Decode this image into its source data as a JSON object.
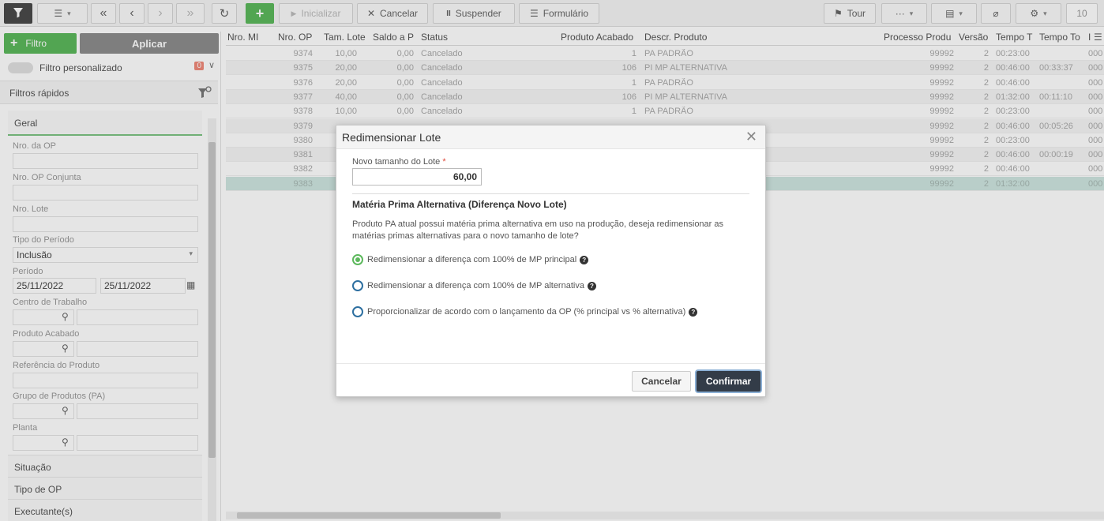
{
  "toolbar": {
    "inicializar": "Inicializar",
    "cancelar": "Cancelar",
    "suspender": "Suspender",
    "formulario": "Formulário",
    "tour": "Tour",
    "page_size": "10"
  },
  "filters": {
    "filtro_btn": "Filtro",
    "aplicar_btn": "Aplicar",
    "personalizado_label": "Filtro personalizado",
    "personalizado_count": "0",
    "rapidos": "Filtros rápidos",
    "geral": "Geral",
    "nro_op": "Nro. da OP",
    "nro_op_conjunta": "Nro. OP Conjunta",
    "nro_lote": "Nro. Lote",
    "tipo_periodo": "Tipo do Período",
    "tipo_periodo_value": "Inclusão",
    "periodo": "Período",
    "periodo_from": "25/11/2022",
    "periodo_to": "25/11/2022",
    "centro_trabalho": "Centro de Trabalho",
    "produto_acabado": "Produto Acabado",
    "referencia_produto": "Referência do Produto",
    "grupo_produtos": "Grupo de Produtos (PA)",
    "planta": "Planta",
    "situacao": "Situação",
    "tipo_op": "Tipo de OP",
    "executantes": "Executante(s)"
  },
  "grid": {
    "headers": [
      "Nro. MI",
      "Nro. OP",
      "Tam. Lote",
      "Saldo a P",
      "Status",
      "Produto Acabado",
      "Descr. Produto",
      "Processo Produ",
      "Versão",
      "Tempo T",
      "Tempo To",
      "I"
    ],
    "rows": [
      [
        "9374",
        "10,00",
        "0,00",
        "Cancelado",
        "1",
        "PA PADRÃO",
        "99992",
        "2",
        "00:23:00",
        "",
        "000"
      ],
      [
        "9375",
        "20,00",
        "0,00",
        "Cancelado",
        "106",
        "PI MP ALTERNATIVA",
        "99992",
        "2",
        "00:46:00",
        "00:33:37",
        "000"
      ],
      [
        "9376",
        "20,00",
        "0,00",
        "Cancelado",
        "1",
        "PA PADRÃO",
        "99992",
        "2",
        "00:46:00",
        "",
        "000"
      ],
      [
        "9377",
        "40,00",
        "0,00",
        "Cancelado",
        "106",
        "PI MP ALTERNATIVA",
        "99992",
        "2",
        "01:32:00",
        "00:11:10",
        "000"
      ],
      [
        "9378",
        "10,00",
        "0,00",
        "Cancelado",
        "1",
        "PA PADRÃO",
        "99992",
        "2",
        "00:23:00",
        "",
        "000"
      ],
      [
        "9379",
        "",
        "",
        "",
        "",
        "",
        "99992",
        "2",
        "00:46:00",
        "00:05:26",
        "000"
      ],
      [
        "9380",
        "",
        "",
        "",
        "",
        "",
        "99992",
        "2",
        "00:23:00",
        "",
        "000"
      ],
      [
        "9381",
        "",
        "",
        "",
        "",
        "",
        "99992",
        "2",
        "00:46:00",
        "00:00:19",
        "000"
      ],
      [
        "9382",
        "",
        "",
        "",
        "",
        "",
        "99992",
        "2",
        "00:46:00",
        "",
        "000"
      ],
      [
        "9383",
        "",
        "",
        "",
        "",
        "",
        "99992",
        "2",
        "01:32:00",
        "",
        "000"
      ]
    ]
  },
  "modal": {
    "title": "Redimensionar Lote",
    "field_label": "Novo tamanho do Lote",
    "required_mark": "*",
    "field_value": "60,00",
    "section_title": "Matéria Prima Alternativa (Diferença Novo Lote)",
    "description": "Produto PA atual possui matéria prima alternativa em uso na produção, deseja redimensionar as matérias primas alternativas para o novo tamanho de lote?",
    "options": [
      "Redimensionar a diferença com 100% de MP principal",
      "Redimensionar a diferença com 100% de MP alternativa",
      "Proporcionalizar de acordo com o lançamento da OP (% principal vs % alternativa)"
    ],
    "selected_option": 0,
    "cancel_label": "Cancelar",
    "confirm_label": "Confirmar"
  }
}
